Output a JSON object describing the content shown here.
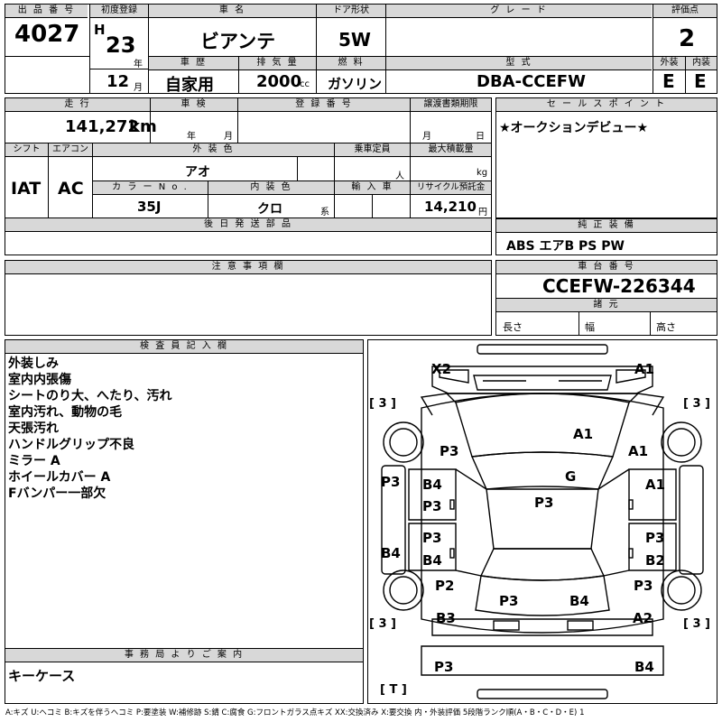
{
  "header_row1": {
    "lot_label": "出 品 番 号",
    "lot_value": "4027",
    "first_reg_label": "初度登録",
    "era": "H",
    "first_reg_year": "23",
    "year_unit": "年",
    "first_reg_month": "12",
    "month_unit": "月",
    "car_name_label": "車 名",
    "car_name": "ビアンテ",
    "door_label": "ドア形状",
    "door_value": "5W",
    "grade_label": "グ レ ー ド",
    "grade_value": "",
    "score_label": "評価点",
    "score_value": "2",
    "exterior_label": "外装",
    "exterior_value": "E",
    "interior_label": "内装",
    "interior_value": "E"
  },
  "header_row2": {
    "history_label": "車 歴",
    "history_value": "自家用",
    "displacement_label": "排 気 量",
    "displacement_value": "2000",
    "displacement_unit": "cc",
    "fuel_label": "燃 料",
    "fuel_value": "ガソリン",
    "model_label": "型 式",
    "model_value": "DBA-CCEFW"
  },
  "specs": {
    "mileage_label": "走 行",
    "mileage_value": "141,272",
    "mileage_unit": "km",
    "inspection_label": "車 検",
    "inspection_year_unit": "年",
    "inspection_month_unit": "月",
    "registration_label": "登 録 番 号",
    "transfer_label": "譲渡書類期限",
    "transfer_month_unit": "月",
    "transfer_day_unit": "日",
    "shift_label": "シフト",
    "shift_value": "IAT",
    "ac_label": "エアコン",
    "ac_value": "AC",
    "ext_color_label": "外 装 色",
    "ext_color_value": "アオ",
    "capacity_label": "乗車定員",
    "capacity_unit": "人",
    "max_load_label": "最大積載量",
    "max_load_unit": "kg",
    "color_no_label": "カ ラ ー N o .",
    "color_no_value": "35J",
    "int_color_label": "内 装 色",
    "int_color_value": "クロ",
    "int_color_unit": "系",
    "import_label": "輸 入 車",
    "recycle_label": "リサイクル預託金",
    "recycle_value": "14,210",
    "recycle_unit": "円",
    "later_parts_label": "後 日 発 送 部 品",
    "notes_label": "注 意 事 項 欄"
  },
  "sales_point": {
    "label": "セ ー ル ス ポ イ ン ト",
    "text": "★オークションデビュー★"
  },
  "equipment": {
    "label": "純 正 装 備",
    "text": "ABS エアB PS PW"
  },
  "chassis": {
    "label": "車 台 番 号",
    "value": "CCEFW-226344",
    "specs_label": "諸 元",
    "length_label": "長さ",
    "width_label": "幅",
    "height_label": "高さ"
  },
  "inspector": {
    "label": "検 査 員 記 入 欄",
    "notes": [
      "外装しみ",
      "室内内張傷",
      "シートのり大、へたり、汚れ",
      "室内汚れ、動物の毛",
      "天張汚れ",
      "ハンドルグリップ不良",
      "ミラー A",
      "ホイールカバー A",
      "Fバンパー一部欠"
    ]
  },
  "office": {
    "label": "事 務 局 よ り ご 案 内",
    "text": "キーケース"
  },
  "diagram": {
    "tire_labels": [
      "[ 3 ]",
      "[ 3 ]",
      "[ 3 ]",
      "[ 3 ]",
      "[ T ]"
    ],
    "marks": [
      {
        "id": "x2",
        "text": "X2"
      },
      {
        "id": "a1-front-right",
        "text": "A1"
      },
      {
        "id": "a1-hood",
        "text": "A1"
      },
      {
        "id": "p3-left-fender",
        "text": "P3"
      },
      {
        "id": "a1-right-fender",
        "text": "A1"
      },
      {
        "id": "p3-left-pillar",
        "text": "P3"
      },
      {
        "id": "b4-left-front-door",
        "text": "B4"
      },
      {
        "id": "g-windshield",
        "text": "G"
      },
      {
        "id": "a1-right-front-door",
        "text": "A1"
      },
      {
        "id": "p3-left-front-door",
        "text": "P3"
      },
      {
        "id": "p3-roof",
        "text": "P3"
      },
      {
        "id": "p3-left-rear-door",
        "text": "P3"
      },
      {
        "id": "p3-right-rear-door",
        "text": "P3"
      },
      {
        "id": "b4-left-sill",
        "text": "B4"
      },
      {
        "id": "b4-left-rear-door",
        "text": "B4"
      },
      {
        "id": "b2-right-rear-door",
        "text": "B2"
      },
      {
        "id": "p2-left-quarter",
        "text": "P2"
      },
      {
        "id": "p3-right-quarter",
        "text": "P3"
      },
      {
        "id": "p3-back-left",
        "text": "P3"
      },
      {
        "id": "b4-back-right",
        "text": "B4"
      },
      {
        "id": "b3-left-rear",
        "text": "B3"
      },
      {
        "id": "a2-right-rear",
        "text": "A2"
      },
      {
        "id": "p3-rear-bumper",
        "text": "P3"
      },
      {
        "id": "b4-rear-bumper",
        "text": "B4"
      }
    ]
  },
  "legend": "A:キズ U:ヘコミ B:キズを伴うヘコミ P:要塗装 W:補修跡 S:錆 C:腐食 G:フロントガラス点キズ XX:交換済み X:要交換 内・外装評価 5段階ランク順(A・B・C・D・E) 1"
}
